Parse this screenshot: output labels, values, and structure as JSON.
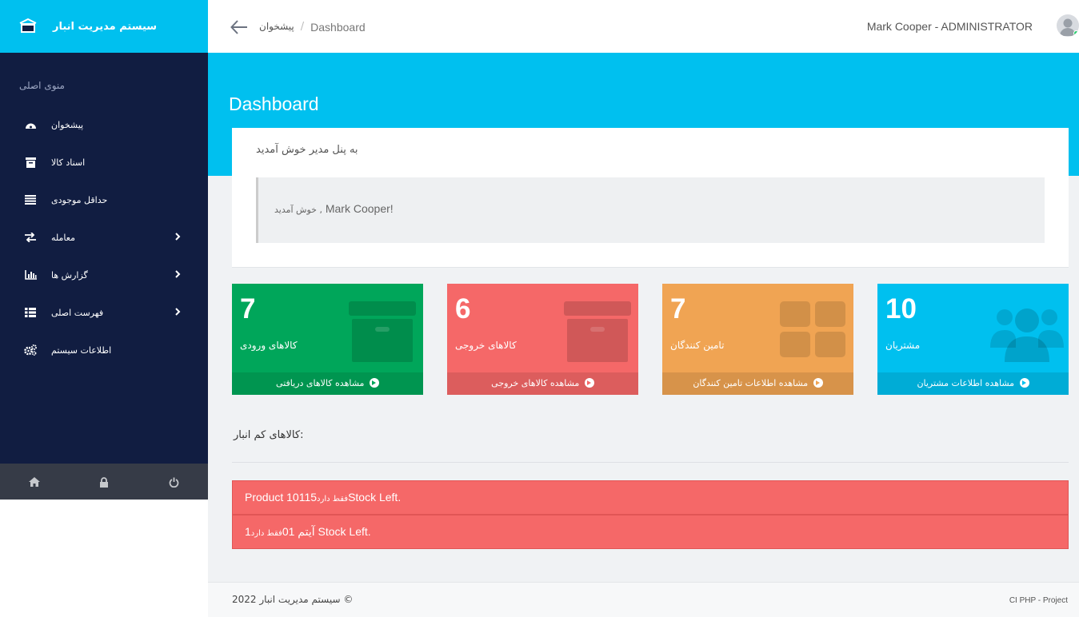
{
  "brand": {
    "title": "سیستم مدیریت انبار"
  },
  "sidebar": {
    "menu_heading": "منوی اصلی",
    "items": [
      {
        "label": "پیشخوان",
        "icon": "dashboard-icon"
      },
      {
        "label": "اسناد کالا",
        "icon": "archive-icon"
      },
      {
        "label": "حداقل موجودی",
        "icon": "list-icon"
      },
      {
        "label": "معامله",
        "icon": "exchange-icon",
        "has_submenu": true
      },
      {
        "label": "گزارش ها",
        "icon": "bar-chart-icon",
        "has_submenu": true
      },
      {
        "label": "فهرست اصلی",
        "icon": "th-list-icon",
        "has_submenu": true
      },
      {
        "label": "اطلاعات سیستم",
        "icon": "cogs-icon"
      }
    ],
    "footer_icons": [
      "home-icon",
      "lock-icon",
      "power-icon"
    ]
  },
  "topbar": {
    "breadcrumb_home": "پیشخوان",
    "breadcrumb_separator": "/",
    "breadcrumb_current": "Dashboard",
    "user": "Mark Cooper - ADMINISTRATOR"
  },
  "page": {
    "title": "Dashboard"
  },
  "welcome": {
    "title": "به پنل مدیر خوش آمدید",
    "greeting_prefix": "خوش آمدید ,",
    "greeting_name": "Mark Cooper!"
  },
  "stats": [
    {
      "value": "7",
      "label": "کالاهای ورودی",
      "link": "مشاهده کالاهای دریافتی",
      "color": "#00a65a",
      "icon": "archive-icon"
    },
    {
      "value": "6",
      "label": "کالاهای خروجی",
      "link": "مشاهده کالاهای خروجی",
      "color": "#f56868",
      "icon": "archive-icon"
    },
    {
      "value": "7",
      "label": "تامین کنندگان",
      "link": "مشاهده اطلاعات تامین کنندگان",
      "color": "#f0a453",
      "icon": "th-large-icon"
    },
    {
      "value": "10",
      "label": "مشتریان",
      "link": "مشاهده اطلاعات مشتریان",
      "color": "#00c0ef",
      "icon": "users-icon"
    }
  ],
  "low_stock": {
    "title": "کالاهای کم انبار:",
    "alerts": [
      {
        "product": "Product 10115",
        "note": "فقط دارد",
        "suffix": "Stock Left."
      },
      {
        "product": "آیتم 01",
        "note": "فقط دارد",
        "qty": "1",
        "suffix": "Stock Left."
      }
    ]
  },
  "footer": {
    "left": "سیستم مدیریت انبار 2022 ©",
    "right": "CI PHP - Project"
  },
  "colors": {
    "accent": "#00c0ef",
    "sidebar": "#111d41",
    "danger": "#f56868"
  }
}
